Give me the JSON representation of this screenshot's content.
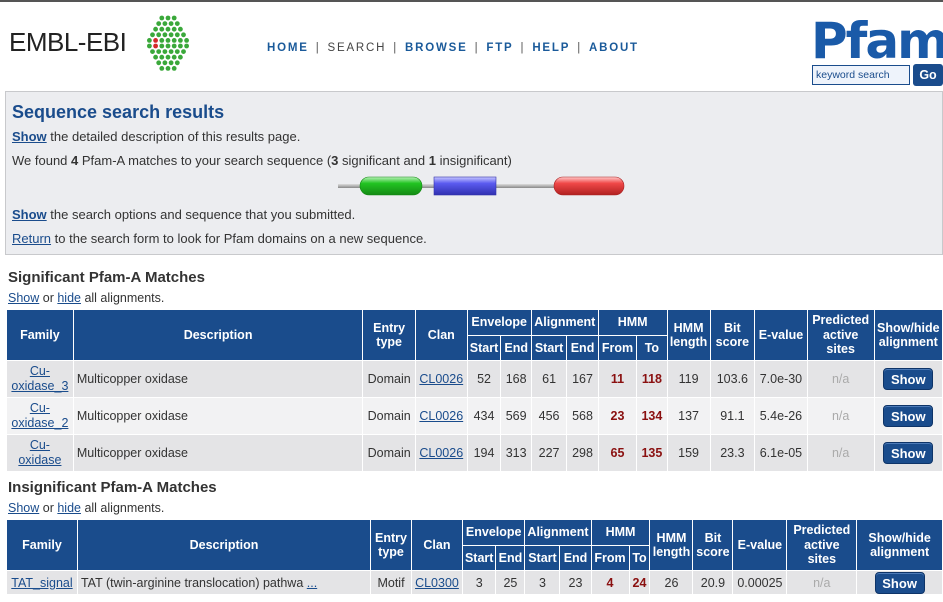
{
  "header": {
    "ebi_logo_text": "EMBL-EBI",
    "nav": [
      {
        "label": "HOME",
        "current": false
      },
      {
        "label": "SEARCH",
        "current": true
      },
      {
        "label": "BROWSE",
        "current": false
      },
      {
        "label": "FTP",
        "current": false
      },
      {
        "label": "HELP",
        "current": false
      },
      {
        "label": "ABOUT",
        "current": false
      }
    ],
    "nav_separator": "|",
    "pfam_logo_text": "Pfam",
    "search_placeholder": "keyword search",
    "go_label": "Go"
  },
  "summary": {
    "title": "Sequence search results",
    "line1_link": "Show",
    "line1_text": " the detailed description of this results page.",
    "line2_a": "We found ",
    "line2_count": "4",
    "line2_b": " Pfam-A matches to your search sequence (",
    "line2_sig": "3",
    "line2_c": " significant and ",
    "line2_insig": "1",
    "line2_d": " insignificant)",
    "line3_link": "Show",
    "line3_text": " the search options and sequence that you submitted.",
    "line4_link": "Return",
    "line4_text": " to the search form to look for Pfam domains on a new sequence.",
    "domain_colors": {
      "green": "#22c422",
      "blue": "#5b5bf0",
      "red": "#f04848"
    }
  },
  "significant": {
    "title": "Significant Pfam-A Matches",
    "show_link": "Show",
    "or_text": " or ",
    "hide_link": "hide",
    "all_text": " all alignments.",
    "headers": {
      "family": "Family",
      "description": "Description",
      "entry_type_1": "Entry",
      "entry_type_2": "type",
      "clan": "Clan",
      "envelope": "Envelope",
      "alignment": "Alignment",
      "hmm": "HMM",
      "start": "Start",
      "end": "End",
      "from": "From",
      "to": "To",
      "hmm_length_1": "HMM",
      "hmm_length_2": "length",
      "bit_score_1": "Bit",
      "bit_score_2": "score",
      "evalue": "E-value",
      "predicted_1": "Predicted",
      "predicted_2": "active",
      "predicted_3": "sites",
      "showhide_1": "Show/hide",
      "showhide_2": "alignment"
    },
    "rows": [
      {
        "family_1": "Cu-",
        "family_2": "oxidase_3",
        "description": "Multicopper oxidase",
        "entry_type": "Domain",
        "clan": "CL0026",
        "env_start": "52",
        "env_end": "168",
        "ali_start": "61",
        "ali_end": "167",
        "hmm_from": "11",
        "hmm_to": "118",
        "hmm_length": "119",
        "bit_score": "103.6",
        "evalue": "7.0e-30",
        "predicted": "n/a",
        "button": "Show"
      },
      {
        "family_1": "Cu-",
        "family_2": "oxidase_2",
        "description": "Multicopper oxidase",
        "entry_type": "Domain",
        "clan": "CL0026",
        "env_start": "434",
        "env_end": "569",
        "ali_start": "456",
        "ali_end": "568",
        "hmm_from": "23",
        "hmm_to": "134",
        "hmm_length": "137",
        "bit_score": "91.1",
        "evalue": "5.4e-26",
        "predicted": "n/a",
        "button": "Show"
      },
      {
        "family_1": "Cu-",
        "family_2": "oxidase",
        "description": "Multicopper oxidase",
        "entry_type": "Domain",
        "clan": "CL0026",
        "env_start": "194",
        "env_end": "313",
        "ali_start": "227",
        "ali_end": "298",
        "hmm_from": "65",
        "hmm_to": "135",
        "hmm_length": "159",
        "bit_score": "23.3",
        "evalue": "6.1e-05",
        "predicted": "n/a",
        "button": "Show"
      }
    ]
  },
  "insignificant": {
    "title": "Insignificant Pfam-A Matches",
    "show_link": "Show",
    "or_text": " or ",
    "hide_link": "hide",
    "all_text": " all alignments.",
    "rows": [
      {
        "family": "TAT_signal",
        "description": "TAT (twin-arginine translocation) pathwa",
        "description_more": "...",
        "entry_type": "Motif",
        "clan": "CL0300",
        "env_start": "3",
        "env_end": "25",
        "ali_start": "3",
        "ali_end": "23",
        "hmm_from": "4",
        "hmm_to": "24",
        "hmm_length": "26",
        "bit_score": "20.9",
        "evalue": "0.00025",
        "predicted": "n/a",
        "button": "Show"
      }
    ]
  }
}
